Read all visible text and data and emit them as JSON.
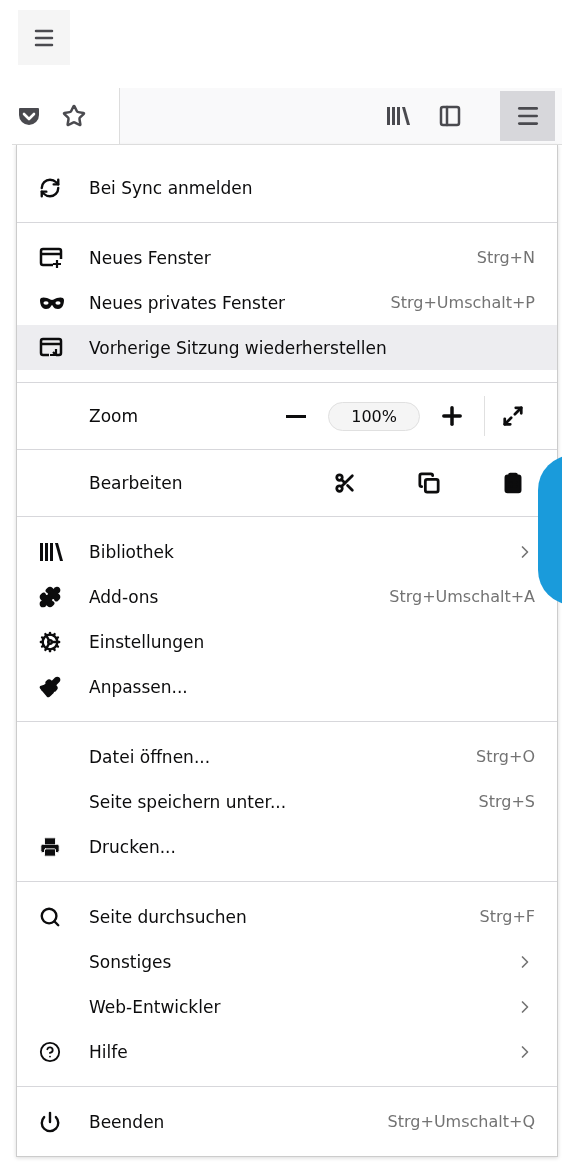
{
  "toolbar": {
    "menu_button_selected": true
  },
  "menu": {
    "sections": [
      {
        "items": [
          {
            "kind": "item",
            "label": "Bei Sync anmelden",
            "highlighted": false,
            "submenu": false
          }
        ]
      },
      {
        "items": [
          {
            "kind": "item",
            "label": "Neues Fenster",
            "shortcut": "Strg+N",
            "highlighted": false,
            "submenu": false
          },
          {
            "kind": "item",
            "label": "Neues privates Fenster",
            "shortcut": "Strg+Umschalt+P",
            "highlighted": false,
            "submenu": false
          },
          {
            "kind": "item",
            "label": "Vorherige Sitzung wiederherstellen",
            "highlighted": true,
            "submenu": false
          }
        ]
      },
      {
        "items": [
          {
            "kind": "zoom",
            "label": "Zoom",
            "value": "100%"
          }
        ]
      },
      {
        "items": [
          {
            "kind": "edit",
            "label": "Bearbeiten"
          }
        ]
      },
      {
        "items": [
          {
            "kind": "item",
            "label": "Bibliothek",
            "highlighted": false,
            "submenu": true
          },
          {
            "kind": "item",
            "label": "Add-ons",
            "shortcut": "Strg+Umschalt+A",
            "highlighted": false,
            "submenu": false
          },
          {
            "kind": "item",
            "label": "Einstellungen",
            "highlighted": false,
            "submenu": false
          },
          {
            "kind": "item",
            "label": "Anpassen...",
            "highlighted": false,
            "submenu": false
          }
        ]
      },
      {
        "items": [
          {
            "kind": "item",
            "label": "Datei öffnen...",
            "shortcut": "Strg+O",
            "highlighted": false,
            "submenu": false
          },
          {
            "kind": "item",
            "label": "Seite speichern unter...",
            "shortcut": "Strg+S",
            "highlighted": false,
            "submenu": false
          },
          {
            "kind": "item",
            "label": "Drucken...",
            "highlighted": false,
            "submenu": false
          }
        ]
      },
      {
        "items": [
          {
            "kind": "item",
            "label": "Seite durchsuchen",
            "shortcut": "Strg+F",
            "highlighted": false,
            "submenu": false
          },
          {
            "kind": "item",
            "label": "Sonstiges",
            "highlighted": false,
            "submenu": true
          },
          {
            "kind": "item",
            "label": "Web-Entwickler",
            "highlighted": false,
            "submenu": true
          },
          {
            "kind": "item",
            "label": "Hilfe",
            "highlighted": false,
            "submenu": true
          }
        ]
      },
      {
        "items": [
          {
            "kind": "item",
            "label": "Beenden",
            "shortcut": "Strg+Umschalt+Q",
            "highlighted": false,
            "submenu": false
          }
        ]
      }
    ]
  }
}
